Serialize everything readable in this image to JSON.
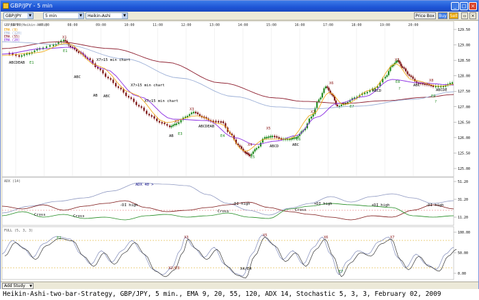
{
  "window": {
    "title": "GBP/JPY - 5 min",
    "minimize": "_",
    "maximize": "□",
    "close": "×"
  },
  "toolbar": {
    "symbol": "GBP/JPY",
    "interval": "5 min",
    "chart_style": "Heikin-Ashi",
    "price_box": "Price Box",
    "buy": "Buy",
    "sell": "Sell"
  },
  "colors": {
    "bull": "#1f8a1f",
    "bear": "#7a1010",
    "ema9": "#f0a000",
    "ema20": "#8a2be2",
    "ema55": "#8b1a2b",
    "ema120": "#9aaed6"
  },
  "price_panel": {
    "header": "GBP/JPY (Heikin-Ashi)",
    "legend": [
      "EMA (9)",
      "EMA (120)",
      "EMA (55)",
      "EMA (20)"
    ],
    "time_labels": [
      "06:00",
      "07:00",
      "08:00",
      "09:00",
      "10:00",
      "11:00",
      "12:00",
      "13:00",
      "14:00",
      "15:00",
      "16:00",
      "17:00",
      "18:00",
      "19:00",
      "20:00"
    ],
    "y_ticks": [
      "129.50",
      "129.00",
      "128.50",
      "128.00",
      "127.50",
      "127.00",
      "126.50",
      "126.00",
      "125.50",
      "125.00"
    ],
    "annotations": [
      {
        "t": "ABCDEAB",
        "x": 10,
        "y": 62,
        "c": "#000"
      },
      {
        "t": "E1",
        "x": 40,
        "y": 62,
        "c": "#1f8a1f"
      },
      {
        "t": "X1",
        "x": 88,
        "y": 25,
        "c": "#8b1a1a"
      },
      {
        "t": "E1",
        "x": 89,
        "y": 45,
        "c": "#1f8a1f"
      },
      {
        "t": "ABC",
        "x": 105,
        "y": 83,
        "c": "#000"
      },
      {
        "t": "X7>15 min chart",
        "x": 138,
        "y": 58,
        "c": "#000"
      },
      {
        "t": "AB",
        "x": 133,
        "y": 110,
        "c": "#000"
      },
      {
        "t": "ABC",
        "x": 148,
        "y": 111,
        "c": "#000"
      },
      {
        "t": "X7>15 min chart",
        "x": 188,
        "y": 95,
        "c": "#000"
      },
      {
        "t": "X7>15 min chart",
        "x": 208,
        "y": 118,
        "c": "#000"
      },
      {
        "t": "X3",
        "x": 274,
        "y": 130,
        "c": "#8b1a1a"
      },
      {
        "t": "X2",
        "x": 252,
        "y": 148,
        "c": "#8b1a1a"
      },
      {
        "t": "ABCDEAB",
        "x": 287,
        "y": 155,
        "c": "#000"
      },
      {
        "t": "AB",
        "x": 244,
        "y": 169,
        "c": "#000"
      },
      {
        "t": "E3",
        "x": 257,
        "y": 166,
        "c": "#1f8a1f"
      },
      {
        "t": "E4",
        "x": 319,
        "y": 169,
        "c": "#1f8a1f"
      },
      {
        "t": "X4",
        "x": 359,
        "y": 182,
        "c": "#8b1a1a"
      },
      {
        "t": "X5",
        "x": 386,
        "y": 158,
        "c": "#8b1a1a"
      },
      {
        "t": "ABCD",
        "x": 391,
        "y": 184,
        "c": "#000"
      },
      {
        "t": "E5",
        "x": 363,
        "y": 200,
        "c": "#1f8a1f"
      },
      {
        "t": "ABC",
        "x": 424,
        "y": 182,
        "c": "#000"
      },
      {
        "t": "E6",
        "x": 430,
        "y": 174,
        "c": "#1f8a1f"
      },
      {
        "t": "X7",
        "x": 451,
        "y": 134,
        "c": "#8b1a1a"
      },
      {
        "t": "X6",
        "x": 478,
        "y": 92,
        "c": "#8b1a1a"
      },
      {
        "t": "E7",
        "x": 508,
        "y": 126,
        "c": "#1f8a1f"
      },
      {
        "t": "ABCD",
        "x": 541,
        "y": 103,
        "c": "#000"
      },
      {
        "t": "X7",
        "x": 574,
        "y": 58,
        "c": "#8b1a1a"
      },
      {
        "t": "E8",
        "x": 575,
        "y": 90,
        "c": "#1f8a1f"
      },
      {
        "t": "?",
        "x": 579,
        "y": 100,
        "c": "#1f8a1f"
      },
      {
        "t": "ABC",
        "x": 601,
        "y": 95,
        "c": "#000"
      },
      {
        "t": "X8",
        "x": 624,
        "y": 88,
        "c": "#8b1a1a"
      },
      {
        "t": "ABCDE",
        "x": 634,
        "y": 102,
        "c": "#000"
      },
      {
        "t": "E9",
        "x": 627,
        "y": 111,
        "c": "#1f8a1f"
      },
      {
        "t": "?",
        "x": 632,
        "y": 119,
        "c": "#1f8a1f"
      }
    ]
  },
  "adx_panel": {
    "header": "ADX (14)",
    "y_ticks": [
      "51.20",
      "31.20",
      "11.20"
    ],
    "annotations": [
      {
        "t": "ADX 40 >",
        "x": 195,
        "y": 12,
        "c": "#000080"
      },
      {
        "t": "-DI high",
        "x": 172,
        "y": 42,
        "c": "#000"
      },
      {
        "t": "-DI high",
        "x": 336,
        "y": 40,
        "c": "#000"
      },
      {
        "t": "+DI high",
        "x": 456,
        "y": 40,
        "c": "#000"
      },
      {
        "t": "+DI high",
        "x": 540,
        "y": 42,
        "c": "#000"
      },
      {
        "t": "-DI high",
        "x": 619,
        "y": 42,
        "c": "#000"
      },
      {
        "t": "Cross",
        "x": 47,
        "y": 56,
        "c": "#000"
      },
      {
        "t": "Cross",
        "x": 104,
        "y": 58,
        "c": "#000"
      },
      {
        "t": "Cross",
        "x": 315,
        "y": 51,
        "c": "#000"
      },
      {
        "t": "Cross",
        "x": 428,
        "y": 49,
        "c": "#000"
      }
    ]
  },
  "stoch_panel": {
    "header": "FULL (5, 3, 3)",
    "y_ticks": [
      "100.00",
      "50.00",
      "0.00"
    ],
    "annotations": [
      {
        "t": "E2",
        "x": 80,
        "y": 18,
        "c": "#1f8a1f"
      },
      {
        "t": "X3",
        "x": 266,
        "y": 17,
        "c": "#8b1a1a"
      },
      {
        "t": "X5",
        "x": 381,
        "y": 14,
        "c": "#8b1a1a"
      },
      {
        "t": "X6",
        "x": 470,
        "y": 17,
        "c": "#8b1a1a"
      },
      {
        "t": "X7",
        "x": 567,
        "y": 17,
        "c": "#8b1a1a"
      },
      {
        "t": "X2/E3",
        "x": 243,
        "y": 62,
        "c": "#8b1a1a"
      },
      {
        "t": "X4/E4",
        "x": 348,
        "y": 63,
        "c": "#000"
      },
      {
        "t": "E7",
        "x": 492,
        "y": 67,
        "c": "#1f8a1f"
      }
    ]
  },
  "status": {
    "add_study": "Add Study"
  },
  "caption": "Heikin-Ashi-two-bar-Strategy, GBP/JPY, 5 min., EMA 9, 20, 55, 120, ADX 14, Stochastic 5, 3, 3, February 02, 2009"
}
